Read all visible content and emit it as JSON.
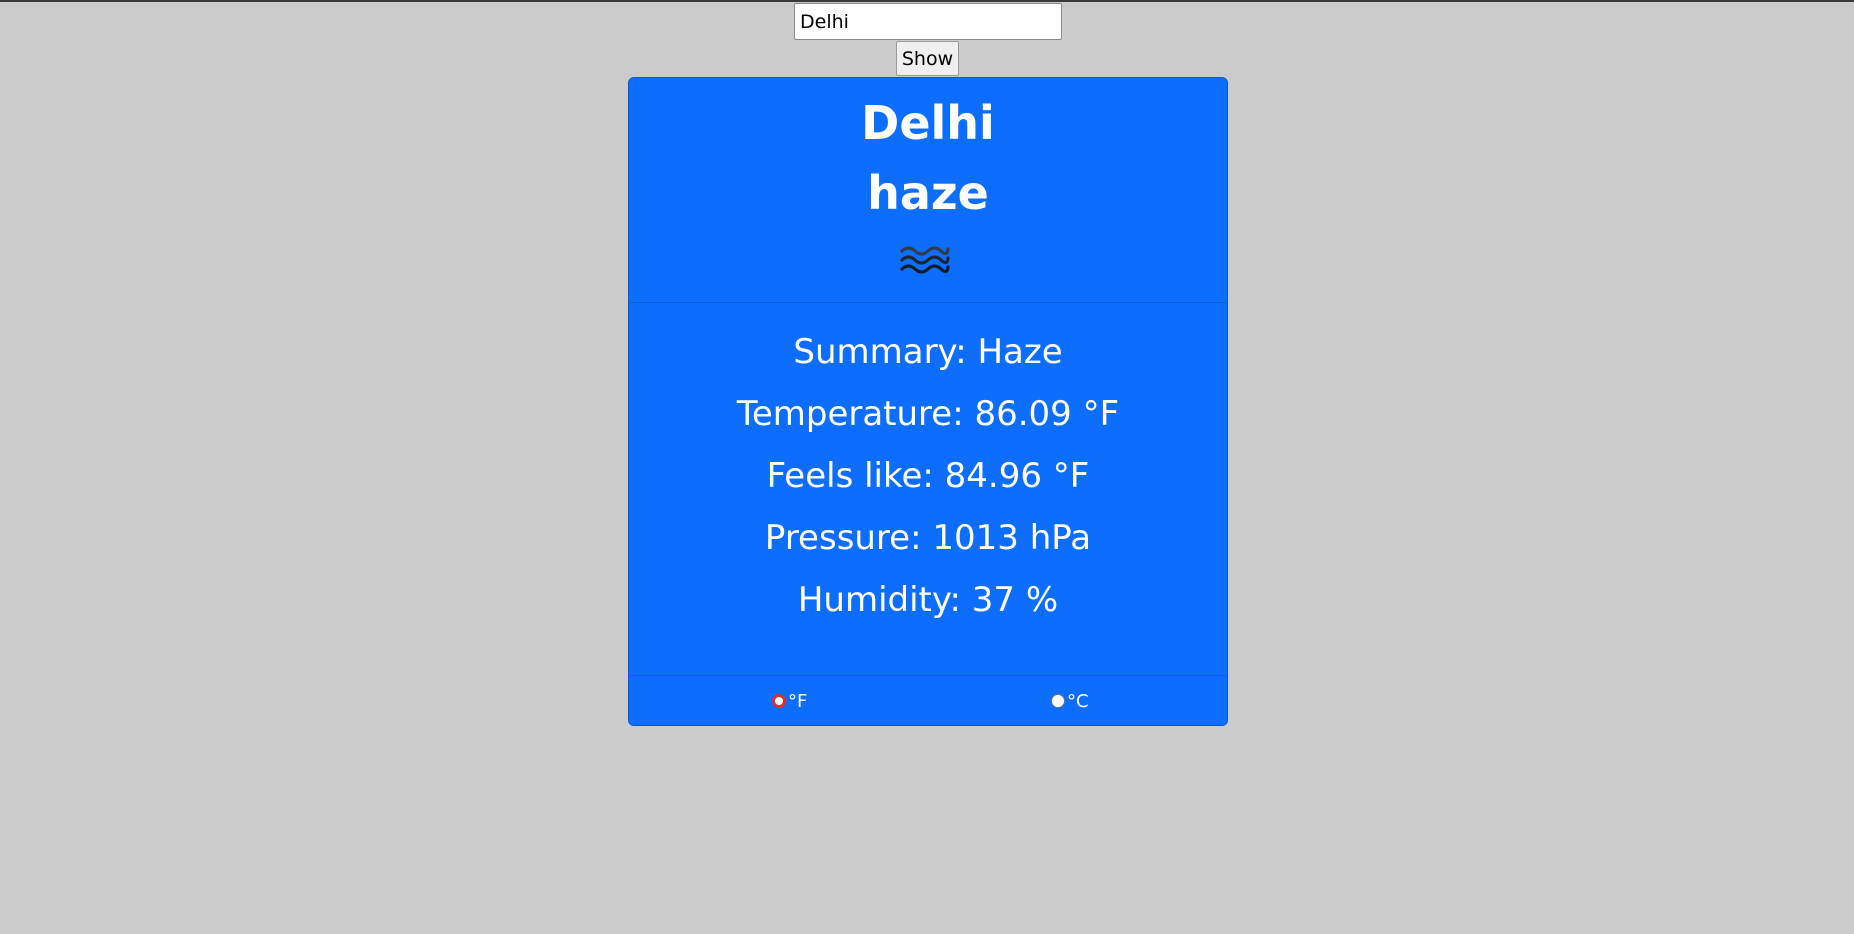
{
  "search": {
    "value": "Delhi",
    "button_label": "Show"
  },
  "card": {
    "city": "Delhi",
    "condition": "haze",
    "icon": "haze-icon",
    "stats": {
      "summary": "Summary: Haze",
      "temperature": "Temperature: 86.09 °F",
      "feels_like": "Feels like: 84.96 °F",
      "pressure": "Pressure: 1013 hPa",
      "humidity": "Humidity: 37 %"
    },
    "units": {
      "fahrenheit_label": "°F",
      "celsius_label": "°C",
      "selected": "fahrenheit"
    }
  },
  "colors": {
    "page_background": "#cbcbcb",
    "card_background": "#0d6efd",
    "radio_selected": "#e22d2d"
  }
}
